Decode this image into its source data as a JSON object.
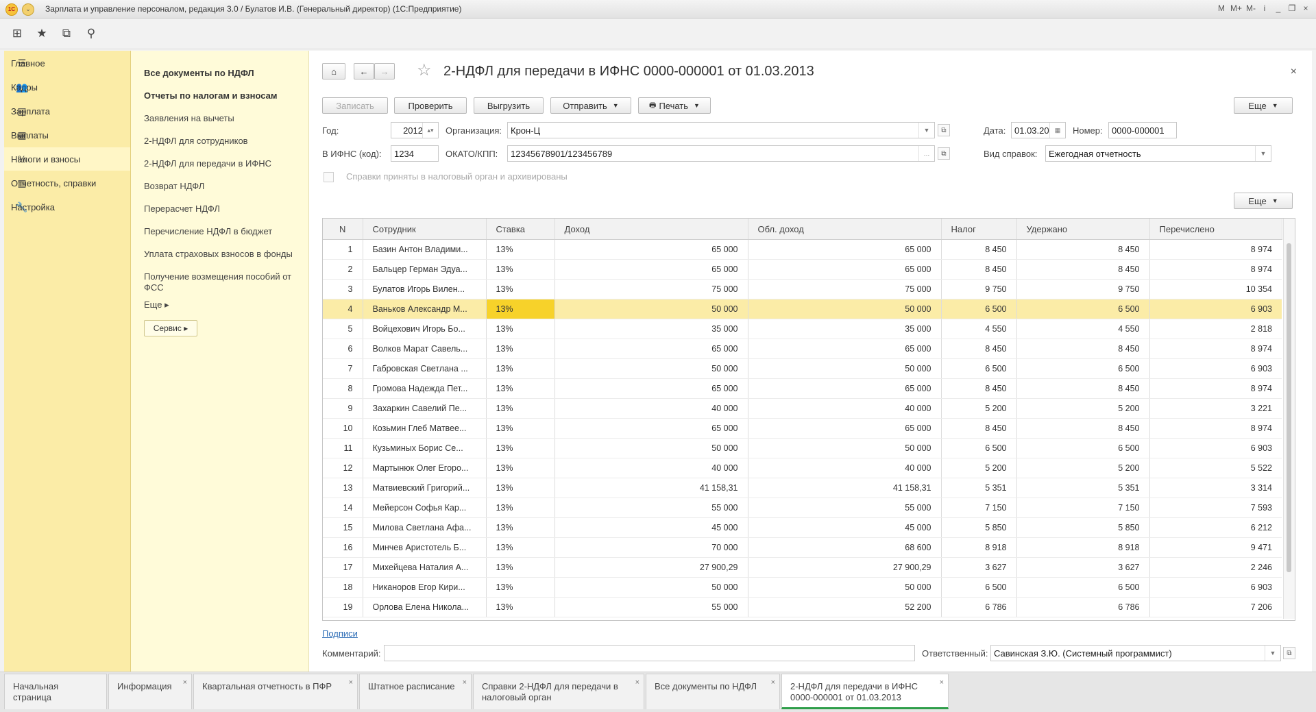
{
  "window": {
    "title": "Зарплата и управление персоналом, редакция 3.0 / Булатов И.В. (Генеральный директор)  (1С:Предприятие)",
    "logo_text": "1С",
    "controls": [
      "M",
      "M+",
      "M-",
      "i",
      "_",
      "❐",
      "×"
    ]
  },
  "toolbar": {
    "icons": [
      "apps-grid-icon",
      "star-icon",
      "history-icon",
      "search-icon"
    ]
  },
  "nav": {
    "items": [
      {
        "icon": "☰",
        "label": "Главное"
      },
      {
        "icon": "👥",
        "label": "Кадры"
      },
      {
        "icon": "▤",
        "label": "Зарплата"
      },
      {
        "icon": "▦",
        "label": "Выплаты"
      },
      {
        "icon": "%",
        "label": "Налоги и взносы",
        "active": true
      },
      {
        "icon": "▥",
        "label": "Отчетность, справки"
      },
      {
        "icon": "🔧",
        "label": "Настройка"
      }
    ]
  },
  "submenu": {
    "items": [
      {
        "label": "Все документы по НДФЛ",
        "bold": true
      },
      {
        "label": "Отчеты по налогам и взносам",
        "bold": true
      },
      {
        "label": "Заявления на вычеты"
      },
      {
        "label": "2-НДФЛ для сотрудников"
      },
      {
        "label": "2-НДФЛ для передачи в ИФНС"
      },
      {
        "label": "Возврат НДФЛ"
      },
      {
        "label": "Перерасчет НДФЛ"
      },
      {
        "label": "Перечисление НДФЛ в бюджет"
      },
      {
        "label": "Уплата страховых взносов в фонды"
      },
      {
        "label": "Получение возмещения пособий от ФСС"
      },
      {
        "label": "Еще ▸"
      }
    ],
    "servis": "Сервис ▸"
  },
  "form": {
    "title": "2-НДФЛ для передачи в ИФНС 0000-000001 от 01.03.2013",
    "close": "×",
    "buttons": {
      "record": "Записать",
      "check": "Проверить",
      "export": "Выгрузить",
      "send": "Отправить",
      "print": "Печать",
      "more": "Еще",
      "more2": "Еще"
    },
    "labels": {
      "year": "Год:",
      "org": "Организация:",
      "date": "Дата:",
      "number": "Номер:",
      "ifns": "В ИФНС (код):",
      "okato": "ОКАТО/КПП:",
      "kind": "Вид справок:",
      "archived": "Справки приняты в налоговый орган и архивированы",
      "comment": "Комментарий:",
      "responsible": "Ответственный:"
    },
    "values": {
      "year": "2012",
      "org": "Крон-Ц",
      "date": "01.03.20",
      "number": "0000-000001",
      "ifns": "1234",
      "okato": "12345678901/123456789",
      "kind": "Ежегодная отчетность",
      "comment": "",
      "responsible": "Савинская З.Ю. (Системный программист)"
    },
    "signatures_link": "Подписи"
  },
  "table": {
    "columns": [
      "N",
      "Сотрудник",
      "Ставка",
      "Доход",
      "Обл. доход",
      "Налог",
      "Удержано",
      "Перечислено"
    ],
    "rows": [
      [
        "1",
        "Базин Антон Владими...",
        "13%",
        "65 000",
        "65 000",
        "8 450",
        "8 450",
        "8 974"
      ],
      [
        "2",
        "Бальцер Герман Эдуа...",
        "13%",
        "65 000",
        "65 000",
        "8 450",
        "8 450",
        "8 974"
      ],
      [
        "3",
        "Булатов Игорь Вилен...",
        "13%",
        "75 000",
        "75 000",
        "9 750",
        "9 750",
        "10 354"
      ],
      [
        "4",
        "Ваньков Александр М...",
        "13%",
        "50 000",
        "50 000",
        "6 500",
        "6 500",
        "6 903"
      ],
      [
        "5",
        "Войцехович Игорь Бо...",
        "13%",
        "35 000",
        "35 000",
        "4 550",
        "4 550",
        "2 818"
      ],
      [
        "6",
        "Волков Марат Савель...",
        "13%",
        "65 000",
        "65 000",
        "8 450",
        "8 450",
        "8 974"
      ],
      [
        "7",
        "Габровская Светлана ...",
        "13%",
        "50 000",
        "50 000",
        "6 500",
        "6 500",
        "6 903"
      ],
      [
        "8",
        "Громова Надежда Пет...",
        "13%",
        "65 000",
        "65 000",
        "8 450",
        "8 450",
        "8 974"
      ],
      [
        "9",
        "Захаркин Савелий Пе...",
        "13%",
        "40 000",
        "40 000",
        "5 200",
        "5 200",
        "3 221"
      ],
      [
        "10",
        "Козьмин Глеб Матвее...",
        "13%",
        "65 000",
        "65 000",
        "8 450",
        "8 450",
        "8 974"
      ],
      [
        "11",
        "Кузьминых Борис Се...",
        "13%",
        "50 000",
        "50 000",
        "6 500",
        "6 500",
        "6 903"
      ],
      [
        "12",
        "Мартынюк Олег Егоро...",
        "13%",
        "40 000",
        "40 000",
        "5 200",
        "5 200",
        "5 522"
      ],
      [
        "13",
        "Матвиевский Григорий...",
        "13%",
        "41 158,31",
        "41 158,31",
        "5 351",
        "5 351",
        "3 314"
      ],
      [
        "14",
        "Мейерсон Софья Кар...",
        "13%",
        "55 000",
        "55 000",
        "7 150",
        "7 150",
        "7 593"
      ],
      [
        "15",
        "Милова Светлана Афа...",
        "13%",
        "45 000",
        "45 000",
        "5 850",
        "5 850",
        "6 212"
      ],
      [
        "16",
        "Минчев Аристотель Б...",
        "13%",
        "70 000",
        "68 600",
        "8 918",
        "8 918",
        "9 471"
      ],
      [
        "17",
        "Михейцева Наталия А...",
        "13%",
        "27 900,29",
        "27 900,29",
        "3 627",
        "3 627",
        "2 246"
      ],
      [
        "18",
        "Никаноров Егор Кири...",
        "13%",
        "50 000",
        "50 000",
        "6 500",
        "6 500",
        "6 903"
      ],
      [
        "19",
        "Орлова Елена Никола...",
        "13%",
        "55 000",
        "52 200",
        "6 786",
        "6 786",
        "7 206"
      ]
    ],
    "selected_index": 3
  },
  "tabs": [
    {
      "label": "Начальная страница"
    },
    {
      "label": "Информация"
    },
    {
      "label": "Квартальная отчетность в ПФР"
    },
    {
      "label": "Штатное расписание"
    },
    {
      "label": "Справки 2-НДФЛ для передачи в налоговый орган"
    },
    {
      "label": "Все документы по НДФЛ"
    },
    {
      "label": "2-НДФЛ для передачи в ИФНС 0000-000001 от 01.03.2013",
      "active": true
    }
  ]
}
